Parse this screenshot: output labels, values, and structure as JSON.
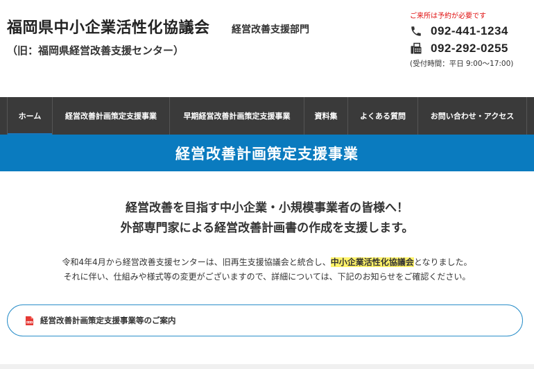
{
  "header": {
    "org_name": "福岡県中小企業活性化協議会",
    "dept": "経営改善支援部門",
    "old_name": "（旧：福岡県経営改善支援センター）"
  },
  "contact": {
    "note": "ご来所は予約が必要です",
    "tel": "092-441-1234",
    "fax": "092-292-0255",
    "hours": "(受付時間：平日 9:00〜17:00)"
  },
  "nav": {
    "items": [
      {
        "label": "ホーム",
        "active": true
      },
      {
        "label": "経営改善計画策定支援事業"
      },
      {
        "label": "早期経営改善計画策定支援事業"
      },
      {
        "label": "資料集"
      },
      {
        "label": "よくある質問"
      },
      {
        "label": "お問い合わせ・アクセス"
      }
    ]
  },
  "banner": {
    "title": "経営改善計画策定支援事業"
  },
  "lead": {
    "line1": "経営改善を目指す中小企業・小規模事業者の皆様へ！",
    "line2": "外部専門家による経営改善計画書の作成を支援します。"
  },
  "notice": {
    "pre": "令和4年4月から経営改善支援センターは、旧再生支援協議会と統合し、",
    "highlight": "中小企業活性化協議会",
    "post": "となりました。",
    "line2": "それに伴い、仕組みや様式等の変更がございますので、詳細については、下記のお知らせをご確認ください。"
  },
  "info": {
    "label": "経営改善計画策定支援事業等のご案内"
  },
  "colors": {
    "nav_bg": "#3a3a3a",
    "banner_bg": "#0a7bbf",
    "alert": "#e01010",
    "highlight": "#fff36a",
    "border": "#2a8ec9"
  }
}
